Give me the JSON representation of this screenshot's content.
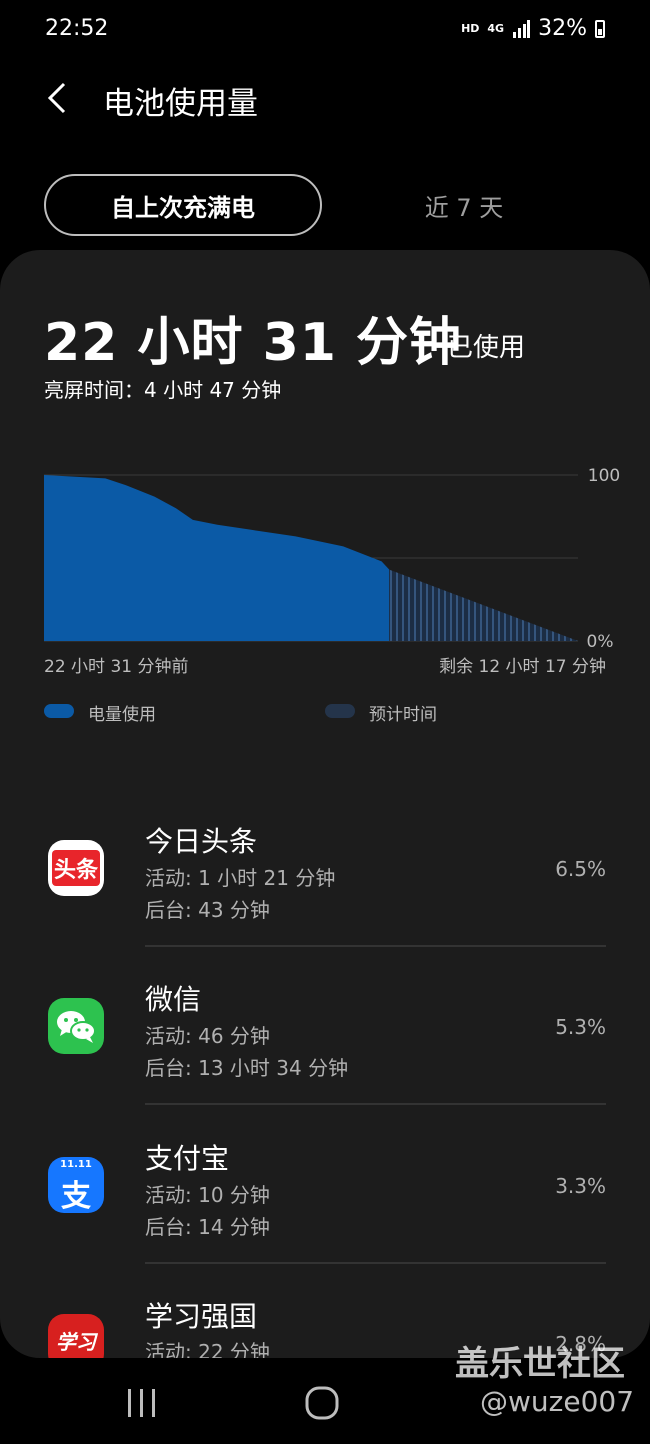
{
  "status_bar": {
    "time": "22:52",
    "network": "HD",
    "signal": "4G",
    "battery": "32%"
  },
  "header": {
    "title": "电池使用量"
  },
  "tabs": [
    {
      "label": "自上次充满电",
      "active": true
    },
    {
      "label": "近 7 天",
      "active": false
    }
  ],
  "summary": {
    "total": "22 小时 31 分钟",
    "suffix": "已使用",
    "screen_on": "亮屏时间：4 小时 47 分钟"
  },
  "chart_data": {
    "type": "area",
    "y_tick_labels": [
      "100",
      "0%"
    ],
    "ylim": [
      0,
      100
    ],
    "x_start_label": "22 小时 31 分钟前",
    "x_end_label": "剩余 12 小时 17 分钟",
    "x_unit": "hours_from_full_charge",
    "xlim": [
      0,
      34.8
    ],
    "series": [
      {
        "name": "电量使用",
        "color": "#0b5aa6",
        "points": [
          [
            0,
            100
          ],
          [
            4.0,
            98
          ],
          [
            5.3,
            94
          ],
          [
            7.2,
            87
          ],
          [
            8.6,
            80
          ],
          [
            9.7,
            73
          ],
          [
            11.3,
            70
          ],
          [
            13.5,
            67
          ],
          [
            16.4,
            63
          ],
          [
            19.5,
            57
          ],
          [
            22.0,
            48
          ],
          [
            22.5,
            43
          ]
        ]
      },
      {
        "name": "预计时间",
        "color": "#1f3550",
        "points": [
          [
            22.5,
            43
          ],
          [
            34.8,
            0
          ]
        ]
      }
    ]
  },
  "legend": [
    {
      "label": "电量使用",
      "color": "#0b5aa6"
    },
    {
      "label": "预计时间",
      "color": "#24344a"
    }
  ],
  "apps": [
    {
      "name": "今日头条",
      "active": "活动: 1 小时 21 分钟",
      "background": "后台: 43 分钟",
      "percent": "6.5%",
      "icon": "toutiao-icon"
    },
    {
      "name": "微信",
      "active": "活动: 46 分钟",
      "background": "后台: 13 小时 34 分钟",
      "percent": "5.3%",
      "icon": "wechat-icon"
    },
    {
      "name": "支付宝",
      "active": "活动: 10 分钟",
      "background": "后台: 14 分钟",
      "percent": "3.3%",
      "icon": "alipay-icon"
    },
    {
      "name": "学习强国",
      "active": "活动: 22 分钟",
      "background": "",
      "percent": "2.8%",
      "icon": "xuexi-icon"
    }
  ],
  "icon_texts": {
    "toutiao": "头条",
    "alipay": "支",
    "alipay_badge": "11.11",
    "xuexi": "学习"
  },
  "watermark": {
    "line1": "盖乐世社区",
    "line2": "@wuze007"
  }
}
